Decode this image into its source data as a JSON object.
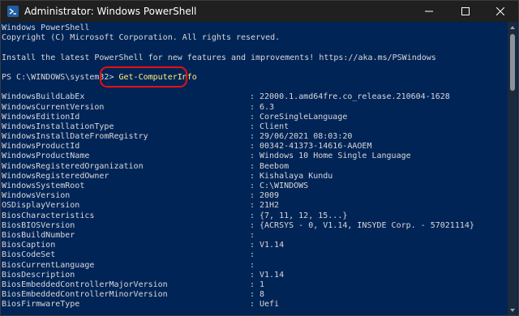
{
  "window": {
    "title": "Administrator: Windows PowerShell",
    "icon": "powershell-icon",
    "controls": [
      "minimize-icon",
      "maximize-icon",
      "close-icon"
    ]
  },
  "console": {
    "banner": [
      "Windows PowerShell",
      "Copyright (C) Microsoft Corporation. All rights reserved.",
      "",
      "Install the latest PowerShell for new features and improvements! https://aka.ms/PSWindows",
      ""
    ],
    "prompt": "PS C:\\WINDOWS\\system32> ",
    "command": "Get-ComputerInfo",
    "separator": ":",
    "properties": [
      {
        "key": "WindowsBuildLabEx",
        "value": "22000.1.amd64fre.co_release.210604-1628"
      },
      {
        "key": "WindowsCurrentVersion",
        "value": "6.3"
      },
      {
        "key": "WindowsEditionId",
        "value": "CoreSingleLanguage"
      },
      {
        "key": "WindowsInstallationType",
        "value": "Client"
      },
      {
        "key": "WindowsInstallDateFromRegistry",
        "value": "29/06/2021 08:03:20"
      },
      {
        "key": "WindowsProductId",
        "value": "00342-41373-14616-AAOEM"
      },
      {
        "key": "WindowsProductName",
        "value": "Windows 10 Home Single Language"
      },
      {
        "key": "WindowsRegisteredOrganization",
        "value": "Beebom"
      },
      {
        "key": "WindowsRegisteredOwner",
        "value": "Kishalaya Kundu"
      },
      {
        "key": "WindowsSystemRoot",
        "value": "C:\\WINDOWS"
      },
      {
        "key": "WindowsVersion",
        "value": "2009"
      },
      {
        "key": "OSDisplayVersion",
        "value": "21H2"
      },
      {
        "key": "BiosCharacteristics",
        "value": "{7, 11, 12, 15...}"
      },
      {
        "key": "BiosBIOSVersion",
        "value": "{ACRSYS - 0, V1.14, INSYDE Corp. - 57021114}"
      },
      {
        "key": "BiosBuildNumber",
        "value": ""
      },
      {
        "key": "BiosCaption",
        "value": "V1.14"
      },
      {
        "key": "BiosCodeSet",
        "value": ""
      },
      {
        "key": "BiosCurrentLanguage",
        "value": ""
      },
      {
        "key": "BiosDescription",
        "value": "V1.14"
      },
      {
        "key": "BiosEmbeddedControllerMajorVersion",
        "value": "1"
      },
      {
        "key": "BiosEmbeddedControllerMinorVersion",
        "value": "8"
      },
      {
        "key": "BiosFirmwareType",
        "value": "Uefi"
      }
    ]
  },
  "colors": {
    "console_background": "#012456",
    "console_text": "#d8d8d8",
    "command_text": "#fff27a",
    "highlight_ring": "#e81010",
    "titlebar": "#202020"
  }
}
